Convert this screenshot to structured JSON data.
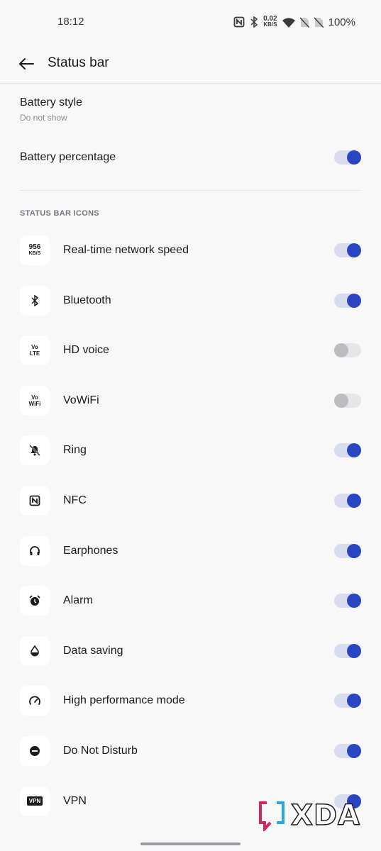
{
  "status_bar": {
    "time": "18:12",
    "speed_value": "0.02",
    "speed_unit": "KB/S",
    "battery": "100%",
    "icons": [
      "nfc-icon",
      "bluetooth-icon",
      "wifi-icon",
      "no-sim-icon",
      "no-sim-icon"
    ]
  },
  "header": {
    "title": "Status bar"
  },
  "battery_style": {
    "title": "Battery style",
    "value": "Do not show"
  },
  "battery_percentage": {
    "title": "Battery percentage",
    "enabled": true
  },
  "section": {
    "title": "STATUS BAR ICONS"
  },
  "items": [
    {
      "label": "Real-time network speed",
      "icon": "network-speed-icon",
      "icon_text_1": "956",
      "icon_text_2": "KB/S",
      "enabled": true
    },
    {
      "label": "Bluetooth",
      "icon": "bluetooth-icon",
      "enabled": true
    },
    {
      "label": "HD voice",
      "icon": "volte-icon",
      "icon_text_1": "Vo",
      "icon_text_2": "LTE",
      "enabled": false
    },
    {
      "label": "VoWiFi",
      "icon": "vowifi-icon",
      "icon_text_1": "Vo",
      "icon_text_2": "WiFi",
      "enabled": false
    },
    {
      "label": "Ring",
      "icon": "bell-off-icon",
      "enabled": true
    },
    {
      "label": "NFC",
      "icon": "nfc-icon",
      "enabled": true
    },
    {
      "label": "Earphones",
      "icon": "headphones-icon",
      "enabled": true
    },
    {
      "label": "Alarm",
      "icon": "alarm-icon",
      "enabled": true
    },
    {
      "label": "Data saving",
      "icon": "data-saver-icon",
      "enabled": true
    },
    {
      "label": "High performance mode",
      "icon": "speedometer-icon",
      "enabled": true
    },
    {
      "label": "Do Not Disturb",
      "icon": "dnd-icon",
      "enabled": true
    },
    {
      "label": "VPN",
      "icon": "vpn-icon",
      "icon_text_1": "VPN",
      "enabled": true
    }
  ],
  "watermark": {
    "text": "XDA"
  },
  "colors": {
    "accent": "#2a45c2",
    "track_on": "#d8dcef",
    "background": "#f8f8f9"
  }
}
